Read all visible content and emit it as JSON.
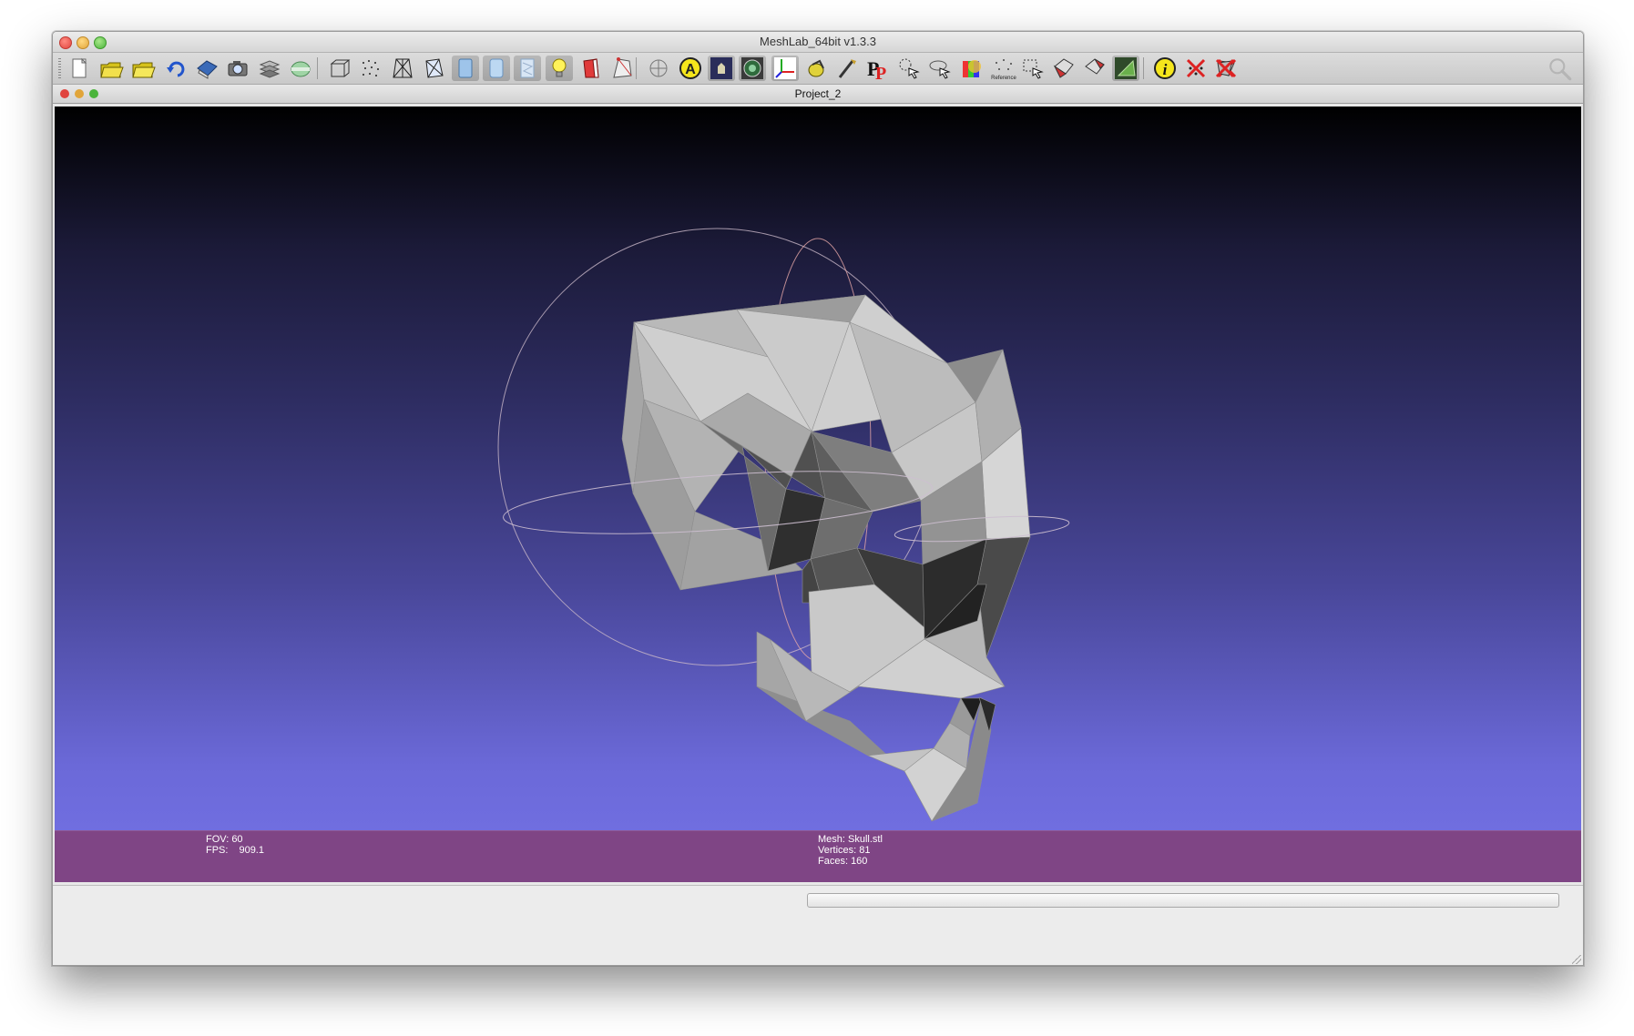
{
  "app": {
    "title": "MeshLab_64bit v1.3.3"
  },
  "document": {
    "title": "Project_2"
  },
  "toolbar": {
    "buttons": [
      {
        "name": "new-project-icon"
      },
      {
        "name": "open-project-icon"
      },
      {
        "name": "import-mesh-icon"
      },
      {
        "name": "reload-icon"
      },
      {
        "name": "save-icon"
      },
      {
        "name": "snapshot-icon"
      },
      {
        "name": "layers-icon"
      },
      {
        "name": "raster-icon"
      },
      {
        "name": "bounding-box-icon"
      },
      {
        "name": "points-icon"
      },
      {
        "name": "wireframe-icon"
      },
      {
        "name": "hidden-lines-icon"
      },
      {
        "name": "flat-shading-icon"
      },
      {
        "name": "smooth-shading-icon"
      },
      {
        "name": "texture-icon"
      },
      {
        "name": "light-icon"
      },
      {
        "name": "backface-icon"
      },
      {
        "name": "selected-faces-icon"
      },
      {
        "name": "align-icon"
      },
      {
        "name": "annotation-icon"
      },
      {
        "name": "reference-icon"
      },
      {
        "name": "shade-icon"
      },
      {
        "name": "axes-icon"
      },
      {
        "name": "manipulator-icon"
      },
      {
        "name": "paint-icon"
      },
      {
        "name": "pick-points-icon"
      },
      {
        "name": "select-vertices-icon"
      },
      {
        "name": "measure-icon"
      },
      {
        "name": "color-icon"
      },
      {
        "name": "reference-points-icon"
      },
      {
        "name": "select-faces-icon"
      },
      {
        "name": "select-connected-icon"
      },
      {
        "name": "select-region-icon"
      },
      {
        "name": "texture-map-icon"
      },
      {
        "name": "info-icon"
      },
      {
        "name": "delete-vertices-icon"
      },
      {
        "name": "delete-faces-icon"
      },
      {
        "name": "delete-all-icon"
      }
    ],
    "reference_label": "Reference"
  },
  "viewport": {
    "fov_label": "FOV: 60",
    "fps_label": "FPS:",
    "fps_value": "909.1",
    "mesh_label": "Mesh: Skull.stl",
    "vertices_label": "Vertices: 81",
    "faces_label": "Faces: 160"
  },
  "colors": {
    "info_bar": "#7f4585",
    "background_top": "#000000",
    "background_bottom": "#7472e6",
    "mesh": "#a8a8a8"
  }
}
